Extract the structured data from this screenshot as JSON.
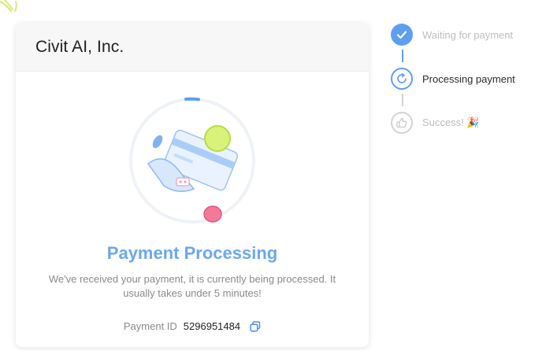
{
  "merchant": {
    "name": "Civit AI, Inc."
  },
  "payment": {
    "title": "Payment Processing",
    "description": "We've received your payment, it is currently being processed. It usually takes under 5 minutes!",
    "id_label": "Payment ID",
    "id_value": "5296951484"
  },
  "steps": [
    {
      "label": "Waiting for payment",
      "state": "done",
      "icon": "check-icon"
    },
    {
      "label": "Processing payment",
      "state": "active",
      "icon": "refresh-icon"
    },
    {
      "label": "Success! 🎉",
      "state": "pending",
      "icon": "thumbs-up-icon"
    }
  ],
  "colors": {
    "accent": "#5d9ef0",
    "title": "#6aa8ee",
    "muted_text": "#bdbdbd",
    "body_text": "#8a8a8a",
    "pending_icon": "#d3d3d3"
  }
}
